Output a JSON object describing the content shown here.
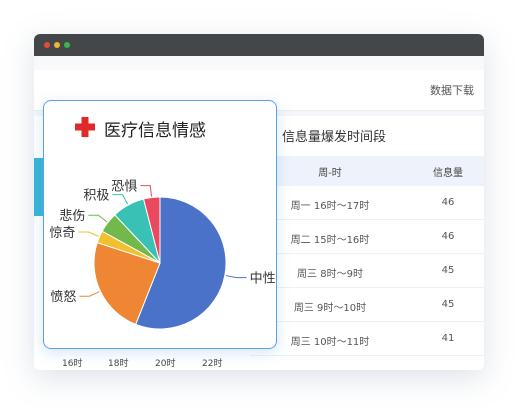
{
  "toolbar": {
    "download_label": "数据下载"
  },
  "table": {
    "title": "信息量爆发时间段",
    "headers": [
      "周-时",
      "信息量"
    ],
    "rows": [
      {
        "time": "周一 16时～17时",
        "count": "46"
      },
      {
        "time": "周二 15时～16时",
        "count": "46"
      },
      {
        "time": "周三 8时～9时",
        "count": "45"
      },
      {
        "time": "周三 9时～10时",
        "count": "45"
      },
      {
        "time": "周三 10时～11时",
        "count": "41"
      }
    ]
  },
  "x_axis_labels": [
    "16时",
    "18时",
    "20时",
    "22时"
  ],
  "card": {
    "title": "医疗信息情感",
    "icon": "red-cross-icon"
  },
  "chart_data": {
    "type": "pie",
    "title": "医疗信息情感",
    "slices": [
      {
        "label": "中性",
        "value": 56,
        "color": "#4a72c8"
      },
      {
        "label": "愤怒",
        "value": 24,
        "color": "#ee8633"
      },
      {
        "label": "惊奇",
        "value": 3,
        "color": "#f2c02f"
      },
      {
        "label": "悲伤",
        "value": 5,
        "color": "#72b94b"
      },
      {
        "label": "积极",
        "value": 8,
        "color": "#38c1b4"
      },
      {
        "label": "恐惧",
        "value": 4,
        "color": "#e94a5e"
      }
    ]
  }
}
